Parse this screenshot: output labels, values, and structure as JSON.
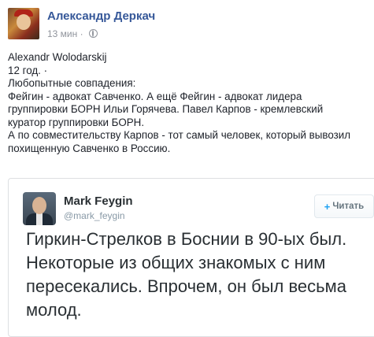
{
  "post": {
    "author": "Александр Деркач",
    "time": "13 мин",
    "separator": "·",
    "lines": [
      "Alexandr Wolodarskij",
      "12 год. ·",
      "Любопытные совпадения:",
      "Фейгин - адвокат Савченко. А ещё Фейгин - адвокат лидера",
      "группировки БОРН Ильи Горячева. Павел Карпов - кремлевский",
      "куратор группировки БОРН.",
      "А по совместительству Карпов - тот самый человек, который вывозил",
      "похищенную Савченко в Россию."
    ]
  },
  "tweet": {
    "name": "Mark Feygin",
    "handle": "@mark_feygin",
    "follow_label": "Читать",
    "follow_icon": "+",
    "lines": [
      "Гиркин-Стрелков в Боснии в 90-ых был.",
      "Некоторые из общих знакомых с ним",
      "пересекались. Впрочем, он был весьма",
      "молод."
    ]
  },
  "colors": {
    "author": "#365899",
    "meta": "#90949c",
    "twitter_blue": "#1da1f2"
  }
}
